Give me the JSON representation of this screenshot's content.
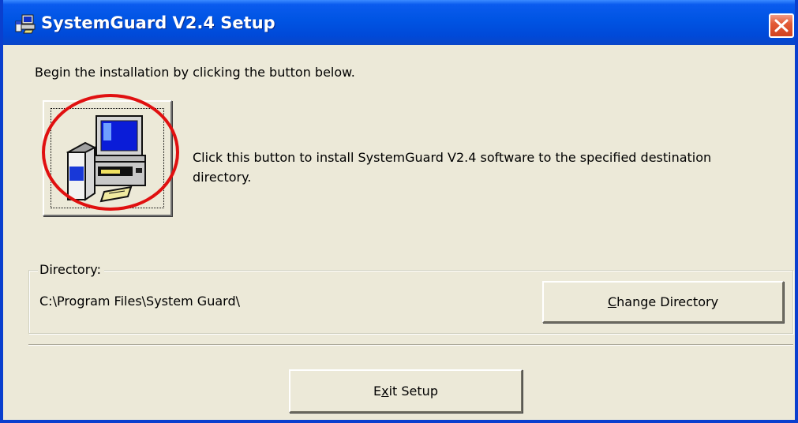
{
  "window": {
    "title": "SystemGuard V2.4 Setup",
    "title_icon": "setup-computer-icon",
    "close_icon": "close-icon",
    "colors": {
      "titlebar": "#0054E3",
      "frame": "#0A3FCE",
      "body": "#ECE9D8",
      "close_button": "#E35B36",
      "highlight_circle": "#E01010"
    }
  },
  "intro": {
    "text": "Begin the installation by clicking the button below."
  },
  "install": {
    "button_icon": "install-computer-icon",
    "description": "Click this button to install SystemGuard V2.4 software to the specified destination directory."
  },
  "directory": {
    "legend": "Directory:",
    "path": "C:\\Program Files\\System Guard\\",
    "change_button": {
      "accel": "C",
      "rest": "hange Directory"
    }
  },
  "exit_button": {
    "before": "E",
    "accel": "x",
    "after": "it Setup"
  }
}
